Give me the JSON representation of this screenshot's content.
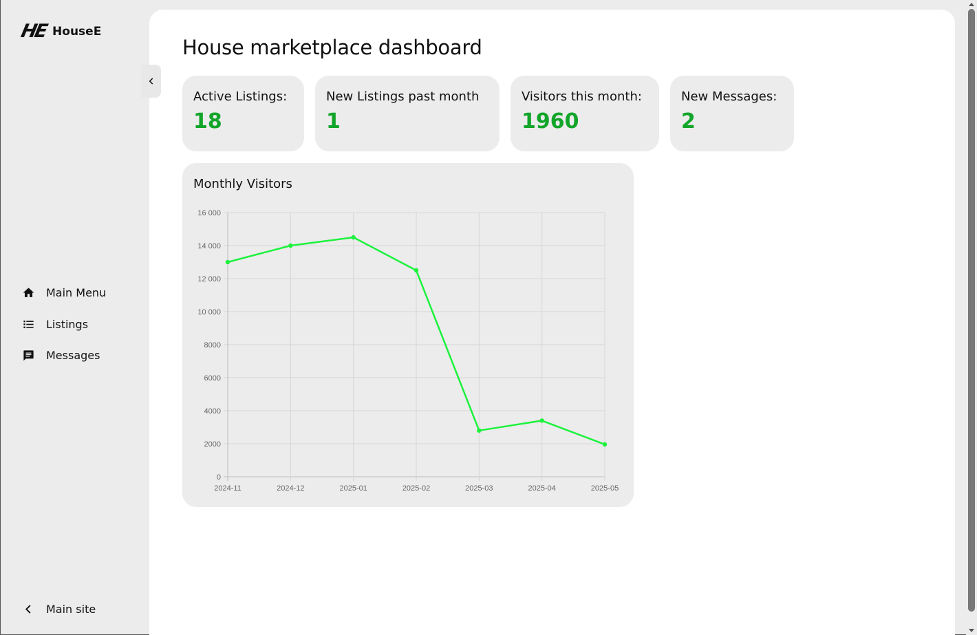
{
  "brand": {
    "logo": "HE",
    "name": "HouseE"
  },
  "sidebar": {
    "items": [
      {
        "label": "Main Menu",
        "icon": "home-icon"
      },
      {
        "label": "Listings",
        "icon": "list-icon"
      },
      {
        "label": "Messages",
        "icon": "message-icon"
      }
    ],
    "main_site": {
      "label": "Main site",
      "icon": "chevron-left-icon"
    }
  },
  "page": {
    "title": "House marketplace dashboard"
  },
  "stats": [
    {
      "label": "Active Listings:",
      "value": "18"
    },
    {
      "label": "New Listings past month",
      "value": "1"
    },
    {
      "label": "Visitors this month:",
      "value": "1960"
    },
    {
      "label": "New Messages:",
      "value": "2"
    }
  ],
  "colors": {
    "accent_value": "#12a52a",
    "line": "#1cf23c",
    "card_bg": "#ececec"
  },
  "chart_data": {
    "type": "line",
    "title": "Monthly Visitors",
    "categories": [
      "2024-11",
      "2024-12",
      "2025-01",
      "2025-02",
      "2025-03",
      "2025-04",
      "2025-05"
    ],
    "series": [
      {
        "values": [
          13000,
          14000,
          14500,
          12500,
          2800,
          3400,
          1960
        ]
      }
    ],
    "ylim": [
      0,
      16000
    ],
    "yticks": [
      "0",
      "2000",
      "4000",
      "6000",
      "8000",
      "10 000",
      "12 000",
      "14 000",
      "16 000"
    ],
    "grid": true,
    "legend": "none"
  }
}
